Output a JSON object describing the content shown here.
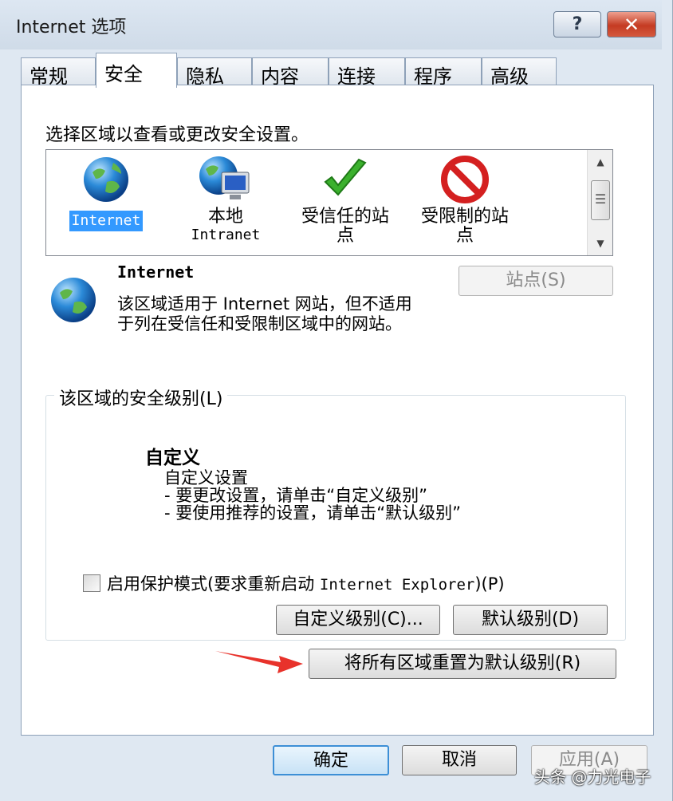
{
  "window": {
    "title": "Internet 选项",
    "help_glyph": "?",
    "close_glyph": "✕"
  },
  "tabs": [
    {
      "label": "常规",
      "active": false
    },
    {
      "label": "安全",
      "active": true
    },
    {
      "label": "隐私",
      "active": false
    },
    {
      "label": "内容",
      "active": false
    },
    {
      "label": "连接",
      "active": false
    },
    {
      "label": "程序",
      "active": false
    },
    {
      "label": "高级",
      "active": false
    }
  ],
  "security": {
    "instruction": "选择区域以查看或更改安全设置。",
    "zones": [
      {
        "label": "Internet",
        "sub": "",
        "icon": "globe-icon",
        "selected": true
      },
      {
        "label": "本地",
        "sub": "Intranet",
        "icon": "globe-monitor-icon",
        "selected": false
      },
      {
        "label": "受信任的站",
        "sub": "点",
        "icon": "checkmark-icon",
        "selected": false
      },
      {
        "label": "受限制的站",
        "sub": "点",
        "icon": "prohibited-icon",
        "selected": false
      }
    ],
    "scroll": {
      "up": "▲",
      "down": "▼",
      "thumb": "☰"
    },
    "selected_zone": {
      "name": "Internet",
      "description": "该区域适用于 Internet 网站，但不适用于列在受信任和受限制区域中的网站。"
    },
    "sites_button": "站点(S)",
    "level_group": {
      "legend": "该区域的安全级别(L)",
      "level_title": "自定义",
      "lines": [
        "自定义设置",
        "- 要更改设置，请单击“自定义级别”",
        "- 要使用推荐的设置，请单击“默认级别”"
      ],
      "protected_mode": {
        "label_a": "启用保护模式(要求重新启动 ",
        "label_b": "Internet Explorer",
        "label_c": ")(P)",
        "checked": false
      },
      "custom_level_button": "自定义级别(C)...",
      "default_level_button": "默认级别(D)"
    },
    "reset_all_button": "将所有区域重置为默认级别(R)"
  },
  "footer": {
    "ok": "确定",
    "cancel": "取消",
    "apply": "应用(A)"
  },
  "watermark": "头条 @力光电子",
  "colors": {
    "accent_arrow": "#e8322b",
    "selection": "#3399ff",
    "ok_border": "#3d8fd6"
  }
}
